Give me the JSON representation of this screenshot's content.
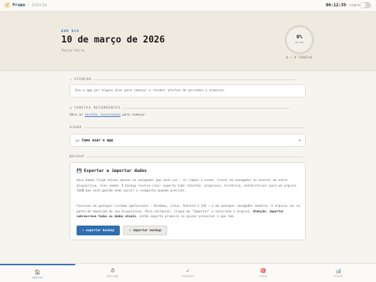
{
  "header": {
    "logo_icon": "🧭",
    "app_name": "Prumo",
    "separator": "·",
    "page_name": "início",
    "clock": "06:12:35",
    "theme_icon": "☀",
    "theme_label": "claro"
  },
  "hero": {
    "greeting": "BOM DIA",
    "date": "10 de março de 2026",
    "weekday": "Terça-feira",
    "progress_pct": "0%",
    "progress_sub": "do dia",
    "progress_value": 0,
    "tasks_count": "0 / 0 TAREFAS"
  },
  "attention": {
    "icon": "⚠",
    "label": "ATENÇÃO",
    "message": "Use o app por alguns dias para começar a receber alertas de períodos e arquivar."
  },
  "recurring": {
    "icon": "▢",
    "label": "TAREFAS RECORRENTES",
    "text_before": "Abra as",
    "link": "tarefas recorrentes",
    "text_after": "para começar."
  },
  "help": {
    "label": "AJUDA",
    "icon": "📖",
    "title": "Como usar o app",
    "chevron": "▾"
  },
  "backup": {
    "label": "BACKUP",
    "icon": "💾",
    "title": "Exportar e importar dados",
    "p1": "Seus dados ficam salvos apenas no navegador que você usa — se limpar o cache, trocar de navegador ou acessar de outro dispositivo, eles somem. O backup resolve isso: exporta tudo (tarefas, progresso, histórico, estatísticas) para um arquivo JSON que você guarda onde quiser e reimporta quando precisar.",
    "p2_start": "Funciona em qualquer sistema operacional — Windows, Linux, Android e iOS — e em qualquer navegador moderno. O arquivo cai na pasta de download do seu dispositivo. Para restaurar, clique em \"Importar\" e selecione o arquivo.",
    "p2_bold": "Atenção: importar sobrescreve todos os dados atuais",
    "p2_end": ", então exporte primeiro se quiser preservar o que tem.",
    "export_label": "⬇ exportar backup",
    "import_label": "⬆ importar backup"
  },
  "nav": [
    {
      "icon": "🏠",
      "label": "INÍCIO"
    },
    {
      "icon": "⏱",
      "label": "ROTINA"
    },
    {
      "icon": "✓",
      "label": "TAREFAS"
    },
    {
      "icon": "🎯",
      "label": "FOCO"
    },
    {
      "icon": "📊",
      "label": "STATS"
    }
  ]
}
